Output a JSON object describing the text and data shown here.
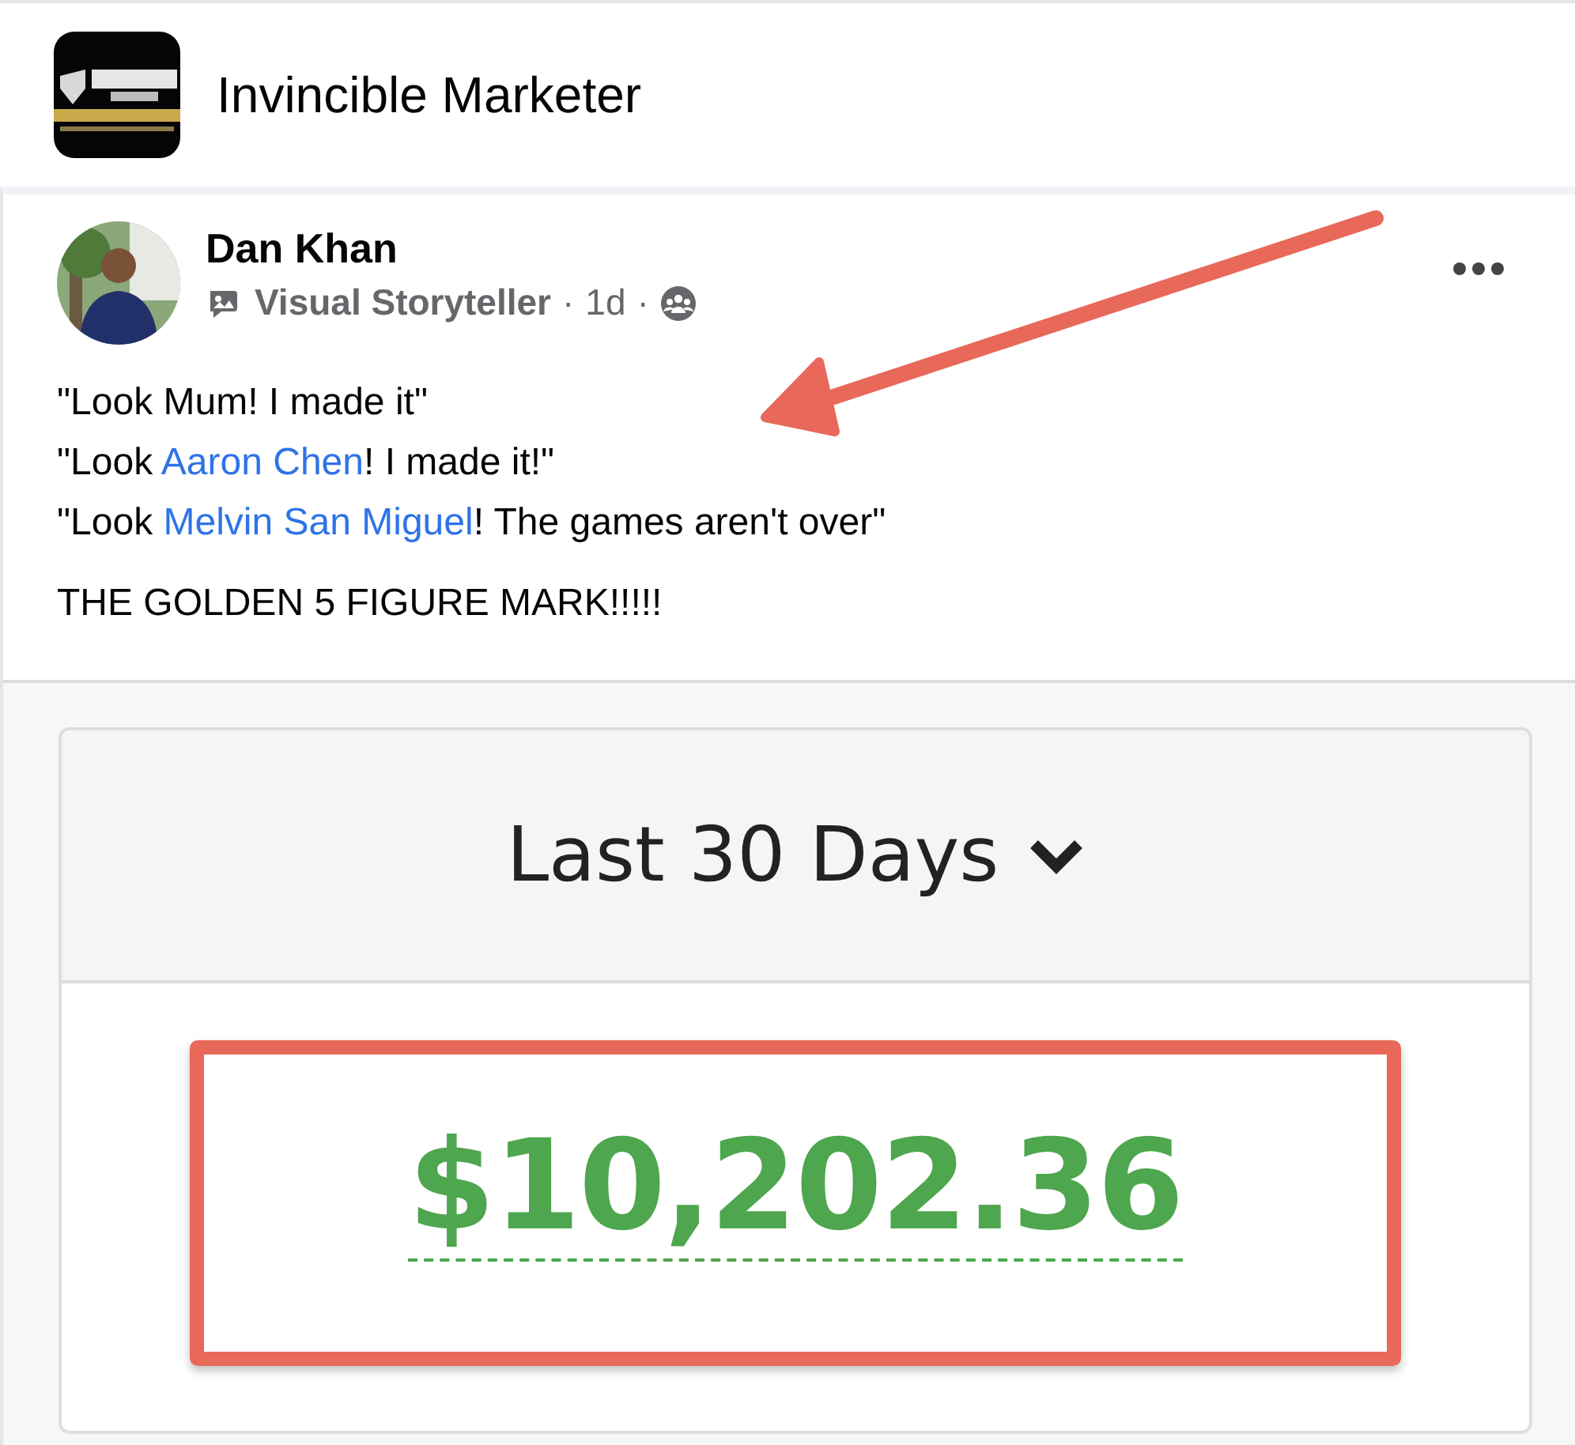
{
  "group": {
    "name": "Invincible Marketer"
  },
  "post": {
    "author": "Dan Khan",
    "badge": "Visual Storyteller",
    "time": "1d",
    "separators": [
      "·",
      "·"
    ],
    "lines": [
      [
        {
          "kind": "text",
          "text": "\"Look Mum! I made it\""
        }
      ],
      [
        {
          "kind": "text",
          "text": "\"Look "
        },
        {
          "kind": "mention",
          "text": "Aaron Chen"
        },
        {
          "kind": "text",
          "text": "! I made it!\""
        }
      ],
      [
        {
          "kind": "text",
          "text": "\"Look "
        },
        {
          "kind": "mention",
          "text": "Melvin San Miguel"
        },
        {
          "kind": "text",
          "text": "! The games aren't over\""
        }
      ]
    ],
    "headline": "THE GOLDEN 5 FIGURE MARK!!!!!"
  },
  "dashboard": {
    "period": "Last 30 Days",
    "amount": "$10,202.36",
    "highlighted": true
  },
  "annotation_arrow": true
}
